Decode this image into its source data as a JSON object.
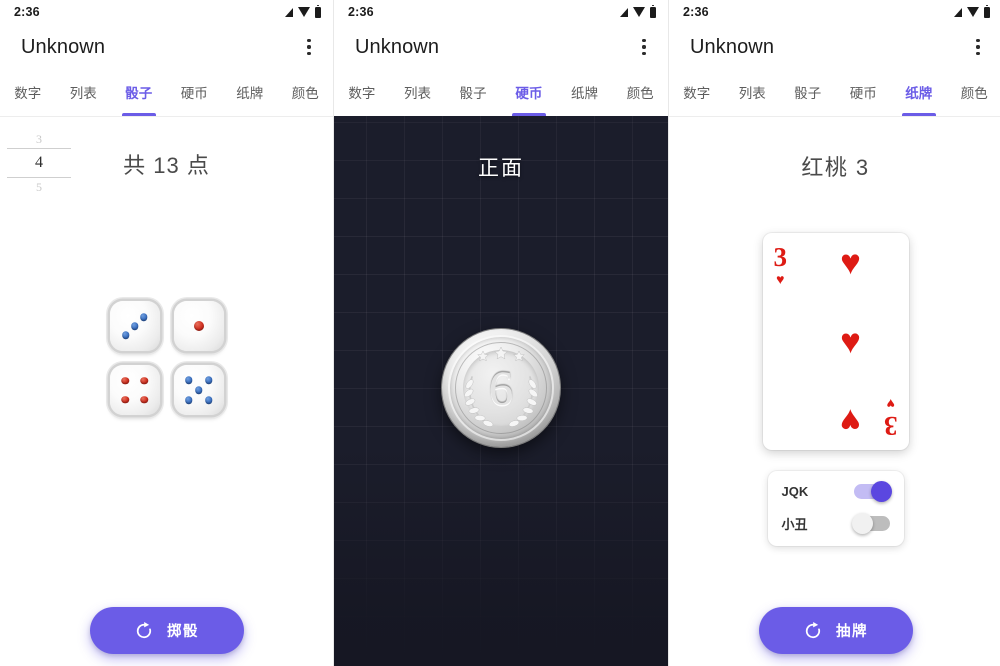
{
  "accent": "#6b5ce7",
  "statusbar": {
    "time": "2:36",
    "icons": [
      "signal-icon",
      "wifi-icon",
      "battery-icon"
    ]
  },
  "appbar": {
    "title": "Unknown",
    "overflow_icon": "more-vertical-icon"
  },
  "tabs": [
    {
      "label": "数字"
    },
    {
      "label": "列表"
    },
    {
      "label": "骰子"
    },
    {
      "label": "硬币"
    },
    {
      "label": "纸牌"
    },
    {
      "label": "颜色"
    }
  ],
  "screens": [
    {
      "active_tab": "骰子",
      "number_picker": {
        "above": "3",
        "selected": "4",
        "below": "5"
      },
      "sum_text": "共 13 点",
      "dice": [
        {
          "value": 3,
          "color": "blue"
        },
        {
          "value": 1,
          "color": "red"
        },
        {
          "value": 4,
          "color": "red"
        },
        {
          "value": 5,
          "color": "blue"
        }
      ],
      "button": {
        "label": "掷骰",
        "icon": "refresh-icon"
      }
    },
    {
      "active_tab": "硬币",
      "result_label": "正面",
      "coin": {
        "face_value": "6",
        "metal": "silver"
      }
    },
    {
      "active_tab": "纸牌",
      "card_title": "红桃 3",
      "card": {
        "rank": "3",
        "suit_symbol": "♥",
        "suit_name": "hearts",
        "pip_count": 3
      },
      "toggles": [
        {
          "label": "JQK",
          "on": true
        },
        {
          "label": "小丑",
          "on": false
        }
      ],
      "button": {
        "label": "抽牌",
        "icon": "refresh-icon"
      }
    }
  ]
}
